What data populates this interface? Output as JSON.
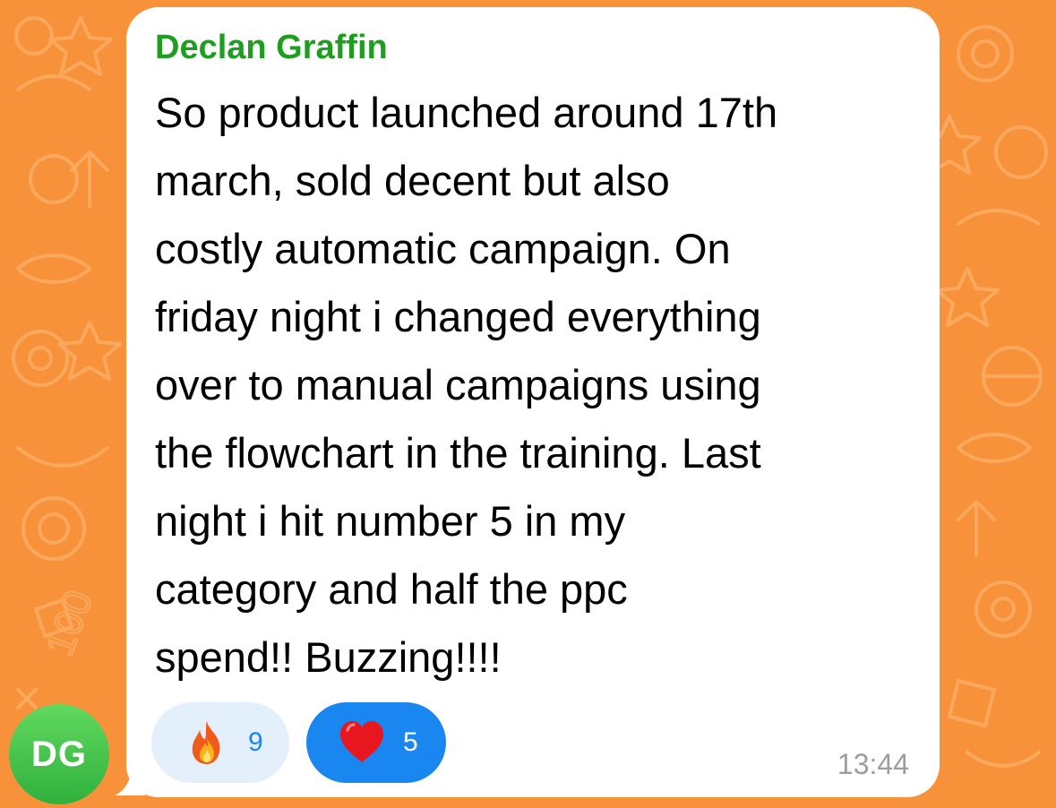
{
  "chat": {
    "background_color": "#f7923a",
    "avatar": {
      "initials": "DG",
      "color": "#3cc24a"
    },
    "message": {
      "sender": "Declan Graffin",
      "sender_color": "#1e9e1e",
      "lines": [
        "So product launched around 17th",
        "march, sold decent but also",
        "costly automatic campaign. On",
        "friday night i changed everything",
        "over to manual campaigns using",
        "the flowchart in the training. Last",
        "night i hit number 5 in my",
        "category and half the ppc",
        "spend!! Buzzing!!!!"
      ],
      "time": "13:44",
      "reactions": [
        {
          "emoji": "fire-icon",
          "count": "9",
          "selected": false
        },
        {
          "emoji": "heart-icon",
          "count": "5",
          "selected": true
        }
      ]
    }
  }
}
